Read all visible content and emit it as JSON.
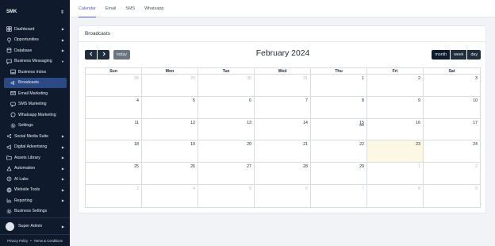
{
  "sidebar": {
    "brand": "SMK",
    "brand_toggle_icon": "chevron-up-down-icon",
    "items": [
      {
        "label": "Dashboard",
        "icon": "grid-icon",
        "caret": true
      },
      {
        "label": "Opportunities",
        "icon": "lightbulb-icon",
        "caret": true
      },
      {
        "label": "Database",
        "icon": "database-icon",
        "caret": true
      },
      {
        "label": "Business Messaging",
        "icon": "message-icon",
        "caret": true,
        "open": true
      },
      {
        "label": "Business Inbox",
        "icon": "inbox-icon",
        "sub": true
      },
      {
        "label": "Broadcasts",
        "icon": "broadcast-icon",
        "sub": true,
        "active": true
      },
      {
        "label": "Email Marketing",
        "icon": "mail-icon",
        "sub": true
      },
      {
        "label": "SMS Marketing",
        "icon": "sms-icon",
        "sub": true
      },
      {
        "label": "Whatsapp Marketing",
        "icon": "whatsapp-icon",
        "sub": true
      },
      {
        "label": "Settings",
        "icon": "gear-icon",
        "sub": true
      },
      {
        "label": "Social Media Suite",
        "icon": "share-icon",
        "caret": true
      },
      {
        "label": "Digital Advertising",
        "icon": "megaphone-icon",
        "caret": true
      },
      {
        "label": "Assets Library",
        "icon": "folder-icon",
        "caret": true
      },
      {
        "label": "Automation",
        "icon": "automation-icon",
        "caret": true
      },
      {
        "label": "AI Labs",
        "icon": "ai-icon",
        "caret": true
      },
      {
        "label": "Website Tools",
        "icon": "globe-icon",
        "caret": true
      },
      {
        "label": "Reporting",
        "icon": "chart-icon",
        "caret": true
      },
      {
        "label": "Business Settings",
        "icon": "gear-icon",
        "caret": false
      }
    ],
    "user_name": "Super Admin",
    "privacy": "Privacy Policy",
    "separator": "•",
    "terms": "Terms & Conditions"
  },
  "tabs": [
    {
      "label": "Calendar",
      "active": true
    },
    {
      "label": "Email",
      "active": false
    },
    {
      "label": "SMS",
      "active": false
    },
    {
      "label": "Whatsapp",
      "active": false
    }
  ],
  "card": {
    "title": "Broadcasts"
  },
  "calendar": {
    "prev_icon": "chevron-left-icon",
    "next_icon": "chevron-right-icon",
    "today_label": "today",
    "title": "February 2024",
    "views": [
      {
        "label": "month",
        "active": true
      },
      {
        "label": "week",
        "active": false
      },
      {
        "label": "day",
        "active": false
      }
    ],
    "days_of_week": [
      "Sun",
      "Mon",
      "Tue",
      "Wed",
      "Thu",
      "Fri",
      "Sat"
    ],
    "weeks": [
      [
        {
          "d": "28",
          "other": true
        },
        {
          "d": "29",
          "other": true
        },
        {
          "d": "30",
          "other": true
        },
        {
          "d": "31",
          "other": true
        },
        {
          "d": "1"
        },
        {
          "d": "2"
        },
        {
          "d": "3"
        }
      ],
      [
        {
          "d": "4"
        },
        {
          "d": "5"
        },
        {
          "d": "6"
        },
        {
          "d": "7"
        },
        {
          "d": "8"
        },
        {
          "d": "9"
        },
        {
          "d": "10"
        }
      ],
      [
        {
          "d": "11"
        },
        {
          "d": "12"
        },
        {
          "d": "13"
        },
        {
          "d": "14"
        },
        {
          "d": "15",
          "underline": true
        },
        {
          "d": "16"
        },
        {
          "d": "17"
        }
      ],
      [
        {
          "d": "18"
        },
        {
          "d": "19"
        },
        {
          "d": "20"
        },
        {
          "d": "21"
        },
        {
          "d": "22"
        },
        {
          "d": "23",
          "today": true
        },
        {
          "d": "24"
        }
      ],
      [
        {
          "d": "25"
        },
        {
          "d": "26"
        },
        {
          "d": "27"
        },
        {
          "d": "28"
        },
        {
          "d": "29"
        },
        {
          "d": "1",
          "other": true
        },
        {
          "d": "2",
          "other": true
        }
      ],
      [
        {
          "d": "3",
          "other": true
        },
        {
          "d": "4",
          "other": true
        },
        {
          "d": "5",
          "other": true
        },
        {
          "d": "6",
          "other": true
        },
        {
          "d": "7",
          "other": true
        },
        {
          "d": "8",
          "other": true
        },
        {
          "d": "9",
          "other": true
        }
      ]
    ]
  },
  "colors": {
    "sidebar_bg": "#0f1b2d",
    "active_item": "#2b4a85",
    "accent": "#4b5bd6",
    "today_bg": "#fcf8e3"
  }
}
